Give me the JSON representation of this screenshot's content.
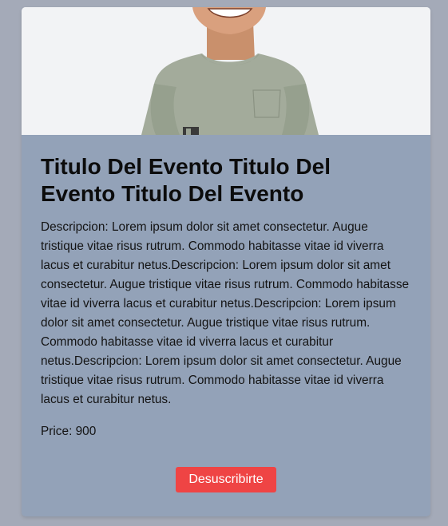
{
  "card": {
    "image_alt": "Hombre sonriente con camiseta verde",
    "title": "Titulo Del Evento Titulo Del Evento Titulo Del Evento",
    "description": "Descripcion: Lorem ipsum dolor sit amet consectetur. Augue tristique vitae risus rutrum. Commodo habitasse vitae id viverra lacus et curabitur netus.Descripcion: Lorem ipsum dolor sit amet consectetur. Augue tristique vitae risus rutrum. Commodo habitasse vitae id viverra lacus et curabitur netus.Descripcion: Lorem ipsum dolor sit amet consectetur. Augue tristique vitae risus rutrum. Commodo habitasse vitae id viverra lacus et curabitur netus.Descripcion: Lorem ipsum dolor sit amet consectetur. Augue tristique vitae risus rutrum. Commodo habitasse vitae id viverra lacus et curabitur netus.",
    "price_label": "Price:",
    "price_value": "900",
    "button_label": "Desuscribirte"
  },
  "colors": {
    "page_background": "#a4aab8",
    "card_background": "#93a2b8",
    "button_background": "#ef4444",
    "button_text": "#ffffff"
  }
}
